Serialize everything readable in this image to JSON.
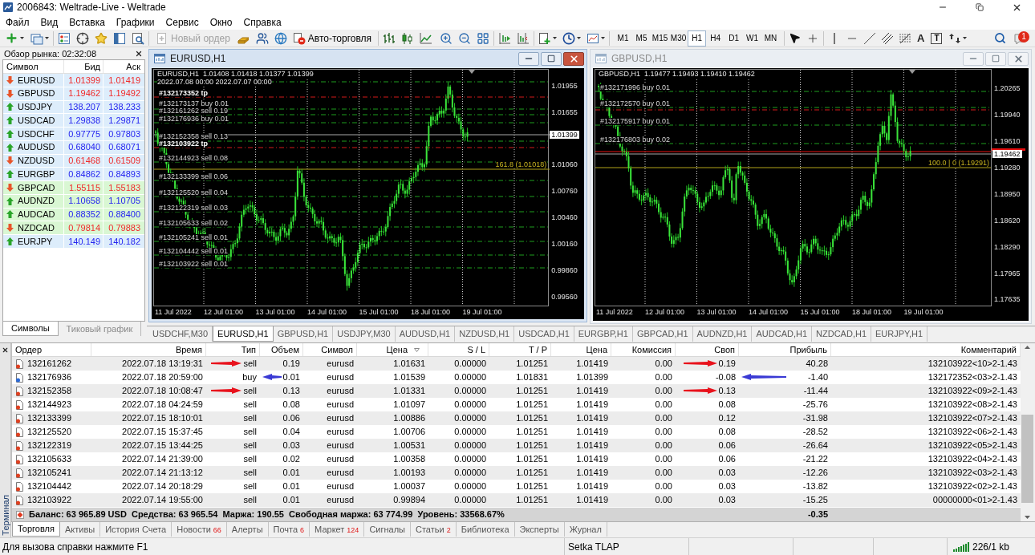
{
  "window": {
    "title": "2006843: Weltrade-Live - Weltrade"
  },
  "menu": [
    "Файл",
    "Вид",
    "Вставка",
    "Графики",
    "Сервис",
    "Окно",
    "Справка"
  ],
  "toolbar": {
    "new_order": {
      "label": "Новый ордер",
      "disabled": true
    },
    "auto_trading": {
      "label": "Авто-торговля"
    },
    "timeframes": [
      {
        "label": "M1",
        "selected": false
      },
      {
        "label": "M5",
        "selected": false
      },
      {
        "label": "M15",
        "selected": false
      },
      {
        "label": "M30",
        "selected": false
      },
      {
        "label": "H1",
        "selected": true
      },
      {
        "label": "H4",
        "selected": false
      },
      {
        "label": "D1",
        "selected": false
      },
      {
        "label": "W1",
        "selected": false
      },
      {
        "label": "MN",
        "selected": false
      }
    ],
    "text_tool": "A",
    "label_tool": "T",
    "notification_count": "1"
  },
  "market_watch": {
    "title": "Обзор рынка: 02:32:08",
    "columns": [
      "Символ",
      "Бид",
      "Аск"
    ],
    "rows": [
      {
        "symbol": "EURUSD",
        "bid": "1.01399",
        "ask": "1.01419",
        "kind": "falling",
        "color": "#ddedfb"
      },
      {
        "symbol": "GBPUSD",
        "bid": "1.19462",
        "ask": "1.19492",
        "kind": "falling",
        "color": "#ddedfb"
      },
      {
        "symbol": "USDJPY",
        "bid": "138.207",
        "ask": "138.233",
        "kind": "rising",
        "color": "#ddedfb"
      },
      {
        "symbol": "USDCAD",
        "bid": "1.29838",
        "ask": "1.29871",
        "kind": "rising",
        "color": "#ddedfb"
      },
      {
        "symbol": "USDCHF",
        "bid": "0.97775",
        "ask": "0.97803",
        "kind": "rising",
        "color": "#ddedfb"
      },
      {
        "symbol": "AUDUSD",
        "bid": "0.68040",
        "ask": "0.68071",
        "kind": "rising",
        "color": "#ddedfb"
      },
      {
        "symbol": "NZDUSD",
        "bid": "0.61468",
        "ask": "0.61509",
        "kind": "falling",
        "color": "#ddedfb"
      },
      {
        "symbol": "EURGBP",
        "bid": "0.84862",
        "ask": "0.84893",
        "kind": "rising",
        "color": "#ddedfb"
      },
      {
        "symbol": "GBPCAD",
        "bid": "1.55115",
        "ask": "1.55183",
        "kind": "falling",
        "color": "#d9f7d3"
      },
      {
        "symbol": "AUDNZD",
        "bid": "1.10658",
        "ask": "1.10705",
        "kind": "rising",
        "color": "#d9f7d3"
      },
      {
        "symbol": "AUDCAD",
        "bid": "0.88352",
        "ask": "0.88400",
        "kind": "rising",
        "color": "#d9f7d3"
      },
      {
        "symbol": "NZDCAD",
        "bid": "0.79814",
        "ask": "0.79883",
        "kind": "falling",
        "color": "#d9f7d3"
      },
      {
        "symbol": "EURJPY",
        "bid": "140.149",
        "ask": "140.182",
        "kind": "rising",
        "color": "#ddedfb"
      }
    ],
    "tabs": [
      {
        "label": "Символы",
        "selected": true
      },
      {
        "label": "Тиковый график",
        "selected": false
      }
    ]
  },
  "charts": [
    {
      "title": "EURUSD,H1",
      "active": true,
      "header": "EURUSD,H1  1.01408 1.01418 1.01377 1.01399",
      "subheader": "2022.07.08 00:00 2022.07.07 00:00",
      "current_price": "1.01399",
      "price_ticks": [
        "1.01955",
        "1.01655",
        "1.01060",
        "1.00760",
        "1.00460",
        "1.00160",
        "0.99860",
        "0.99560"
      ],
      "time_labels": [
        "11 Jul 2022",
        "12 Jul 01:00",
        "13 Jul 01:00",
        "14 Jul 01:00",
        "15 Jul 01:00",
        "18 Jul 01:00",
        "19 Jul 01:00"
      ],
      "lines": [
        {
          "kind": "order"
        },
        {
          "kind": "tp",
          "label": "#132173352 tp"
        },
        {
          "kind": "order",
          "label": "#132173137 buy 0.01"
        },
        {
          "kind": "order",
          "label": "#132161262 sell 0.19"
        },
        {
          "kind": "order",
          "label": "#132176936 buy 0.01"
        },
        {
          "kind": "bid"
        },
        {
          "kind": "order",
          "label": "#132152358 sell 0.13"
        },
        {
          "kind": "tp",
          "label": "#132103922 tp"
        },
        {
          "kind": "order",
          "label": "#132144923 sell 0.08"
        },
        {
          "kind": "level",
          "label": "161.8 (1.01018)"
        },
        {
          "kind": "order",
          "label": "#132133399 sell 0.06"
        },
        {
          "kind": "order",
          "label": "#132125520 sell 0.04"
        },
        {
          "kind": "order",
          "label": "#132122319 sell 0.03"
        },
        {
          "kind": "order",
          "label": "#132105633 sell 0.02"
        },
        {
          "kind": "order",
          "label": "#132105241 sell 0.01"
        },
        {
          "kind": "order",
          "label": "#132104442 sell 0.01"
        },
        {
          "kind": "order",
          "label": "#132103922 sell 0.01"
        }
      ]
    },
    {
      "title": "GBPUSD,H1",
      "active": false,
      "header": "GBPUSD,H1  1.19477 1.19493 1.19410 1.19462",
      "current_price": "1.19462",
      "price_ticks": [
        "1.20265",
        "1.19940",
        "1.19610",
        "1.19280",
        "1.18950",
        "1.18620",
        "1.18290",
        "1.17965",
        "1.17635"
      ],
      "time_labels": [
        "11 Jul 2022",
        "12 Jul 01:00",
        "13 Jul 01:00",
        "14 Jul 01:00",
        "15 Jul 01:00",
        "18 Jul 01:00",
        "19 Jul 01:00"
      ],
      "lines": [
        {
          "kind": "order",
          "label": "#132171996 buy 0.01"
        },
        {
          "kind": "order",
          "label": "#132172570 buy 0.01"
        },
        {
          "kind": "tp"
        },
        {
          "kind": "order",
          "label": "#132175917 buy 0.01"
        },
        {
          "kind": "order",
          "label": "#132176803 buy 0.02"
        },
        {
          "kind": "ask"
        },
        {
          "kind": "bid"
        },
        {
          "kind": "level",
          "label": "100.0 | 0 (1.19291)"
        }
      ]
    }
  ],
  "chart_tabs": [
    {
      "label": "USDCHF,M30",
      "selected": false
    },
    {
      "label": "EURUSD,H1",
      "selected": true
    },
    {
      "label": "GBPUSD,H1",
      "selected": false
    },
    {
      "label": "USDJPY,M30",
      "selected": false
    },
    {
      "label": "AUDUSD,H1",
      "selected": false
    },
    {
      "label": "NZDUSD,H1",
      "selected": false
    },
    {
      "label": "USDCAD,H1",
      "selected": false
    },
    {
      "label": "EURGBP,H1",
      "selected": false
    },
    {
      "label": "GBPCAD,H1",
      "selected": false
    },
    {
      "label": "AUDNZD,H1",
      "selected": false
    },
    {
      "label": "AUDCAD,H1",
      "selected": false
    },
    {
      "label": "NZDCAD,H1",
      "selected": false
    },
    {
      "label": "EURJPY,H1",
      "selected": false
    }
  ],
  "terminal": {
    "label": "Терминал",
    "columns": [
      {
        "label": "Ордер",
        "sorted": false
      },
      {
        "label": "Время",
        "sorted": false
      },
      {
        "label": "Тип",
        "sorted": false
      },
      {
        "label": "Объем",
        "sorted": false
      },
      {
        "label": "Символ",
        "sorted": false
      },
      {
        "label": "Цена",
        "sorted": true
      },
      {
        "label": "S / L",
        "sorted": false
      },
      {
        "label": "T / P",
        "sorted": false
      },
      {
        "label": "Цена",
        "sorted": false
      },
      {
        "label": "Комиссия",
        "sorted": false
      },
      {
        "label": "Своп",
        "sorted": false
      },
      {
        "label": "Прибыль",
        "sorted": false
      },
      {
        "label": "Комментарий",
        "sorted": false
      }
    ],
    "rows": [
      {
        "kind": "sell",
        "cells": [
          "132161262",
          "2022.07.18 13:19:31",
          "sell",
          "0.19",
          "eurusd",
          "1.01631",
          "0.00000",
          "1.01251",
          "1.01419",
          "0.00",
          "0.19",
          "40.28",
          "132103922<10>2-1.43"
        ],
        "arrow": {
          "kind": "rightward",
          "color": "#e8121c"
        }
      },
      {
        "kind": "buy",
        "cells": [
          "132176936",
          "2022.07.18 20:59:00",
          "buy",
          "0.01",
          "eurusd",
          "1.01539",
          "0.00000",
          "1.01831",
          "1.01399",
          "0.00",
          "-0.08",
          "-1.40",
          "132172352<03>2-1.43"
        ],
        "arrow": {
          "kind": "leftward",
          "color": "#3a3ad4"
        }
      },
      {
        "kind": "sell",
        "cells": [
          "132152358",
          "2022.07.18 10:08:47",
          "sell",
          "0.13",
          "eurusd",
          "1.01331",
          "0.00000",
          "1.01251",
          "1.01419",
          "0.00",
          "0.13",
          "-11.44",
          "132103922<09>2-1.43"
        ],
        "arrow": {
          "kind": "rightward",
          "color": "#e8121c"
        }
      },
      {
        "kind": "sell",
        "cells": [
          "132144923",
          "2022.07.18 04:24:59",
          "sell",
          "0.08",
          "eurusd",
          "1.01097",
          "0.00000",
          "1.01251",
          "1.01419",
          "0.00",
          "0.08",
          "-25.76",
          "132103922<08>2-1.43"
        ]
      },
      {
        "kind": "sell",
        "cells": [
          "132133399",
          "2022.07.15 18:10:01",
          "sell",
          "0.06",
          "eurusd",
          "1.00886",
          "0.00000",
          "1.01251",
          "1.01419",
          "0.00",
          "0.12",
          "-31.98",
          "132103922<07>2-1.43"
        ]
      },
      {
        "kind": "sell",
        "cells": [
          "132125520",
          "2022.07.15 15:37:45",
          "sell",
          "0.04",
          "eurusd",
          "1.00706",
          "0.00000",
          "1.01251",
          "1.01419",
          "0.00",
          "0.08",
          "-28.52",
          "132103922<06>2-1.43"
        ]
      },
      {
        "kind": "sell",
        "cells": [
          "132122319",
          "2022.07.15 13:44:25",
          "sell",
          "0.03",
          "eurusd",
          "1.00531",
          "0.00000",
          "1.01251",
          "1.01419",
          "0.00",
          "0.06",
          "-26.64",
          "132103922<05>2-1.43"
        ]
      },
      {
        "kind": "sell",
        "cells": [
          "132105633",
          "2022.07.14 21:39:00",
          "sell",
          "0.02",
          "eurusd",
          "1.00358",
          "0.00000",
          "1.01251",
          "1.01419",
          "0.00",
          "0.06",
          "-21.22",
          "132103922<04>2-1.43"
        ]
      },
      {
        "kind": "sell",
        "cells": [
          "132105241",
          "2022.07.14 21:13:12",
          "sell",
          "0.01",
          "eurusd",
          "1.00193",
          "0.00000",
          "1.01251",
          "1.01419",
          "0.00",
          "0.03",
          "-12.26",
          "132103922<03>2-1.43"
        ]
      },
      {
        "kind": "sell",
        "cells": [
          "132104442",
          "2022.07.14 20:18:29",
          "sell",
          "0.01",
          "eurusd",
          "1.00037",
          "0.00000",
          "1.01251",
          "1.01419",
          "0.00",
          "0.03",
          "-13.82",
          "132103922<02>2-1.43"
        ]
      },
      {
        "kind": "sell",
        "cells": [
          "132103922",
          "2022.07.14 19:55:00",
          "sell",
          "0.01",
          "eurusd",
          "0.99894",
          "0.00000",
          "1.01251",
          "1.01419",
          "0.00",
          "0.03",
          "-15.25",
          "00000000<01>2-1.43"
        ]
      }
    ],
    "summary": {
      "text": "Баланс: 63 965.89 USD  Средства: 63 965.54  Маржа: 190.55  Свободная маржа: 63 774.99  Уровень: 33568.67%",
      "profit": "-0.35"
    },
    "tabs": [
      {
        "label": "Торговля",
        "selected": true
      },
      {
        "label": "Активы",
        "selected": false
      },
      {
        "label": "История Счета",
        "selected": false
      },
      {
        "label": "Новости",
        "count": "66",
        "selected": false
      },
      {
        "label": "Алерты",
        "selected": false
      },
      {
        "label": "Почта",
        "count": "6",
        "selected": false
      },
      {
        "label": "Маркет",
        "count": "124",
        "selected": false
      },
      {
        "label": "Сигналы",
        "selected": false
      },
      {
        "label": "Статьи",
        "count": "2",
        "selected": false
      },
      {
        "label": "Библиотека",
        "selected": false
      },
      {
        "label": "Эксперты",
        "selected": false
      },
      {
        "label": "Журнал",
        "selected": false
      }
    ]
  },
  "status_bar": {
    "help": "Для вызова справки нажмите F1",
    "profile": "Setka TLAP",
    "traffic": "226/1 kb"
  }
}
